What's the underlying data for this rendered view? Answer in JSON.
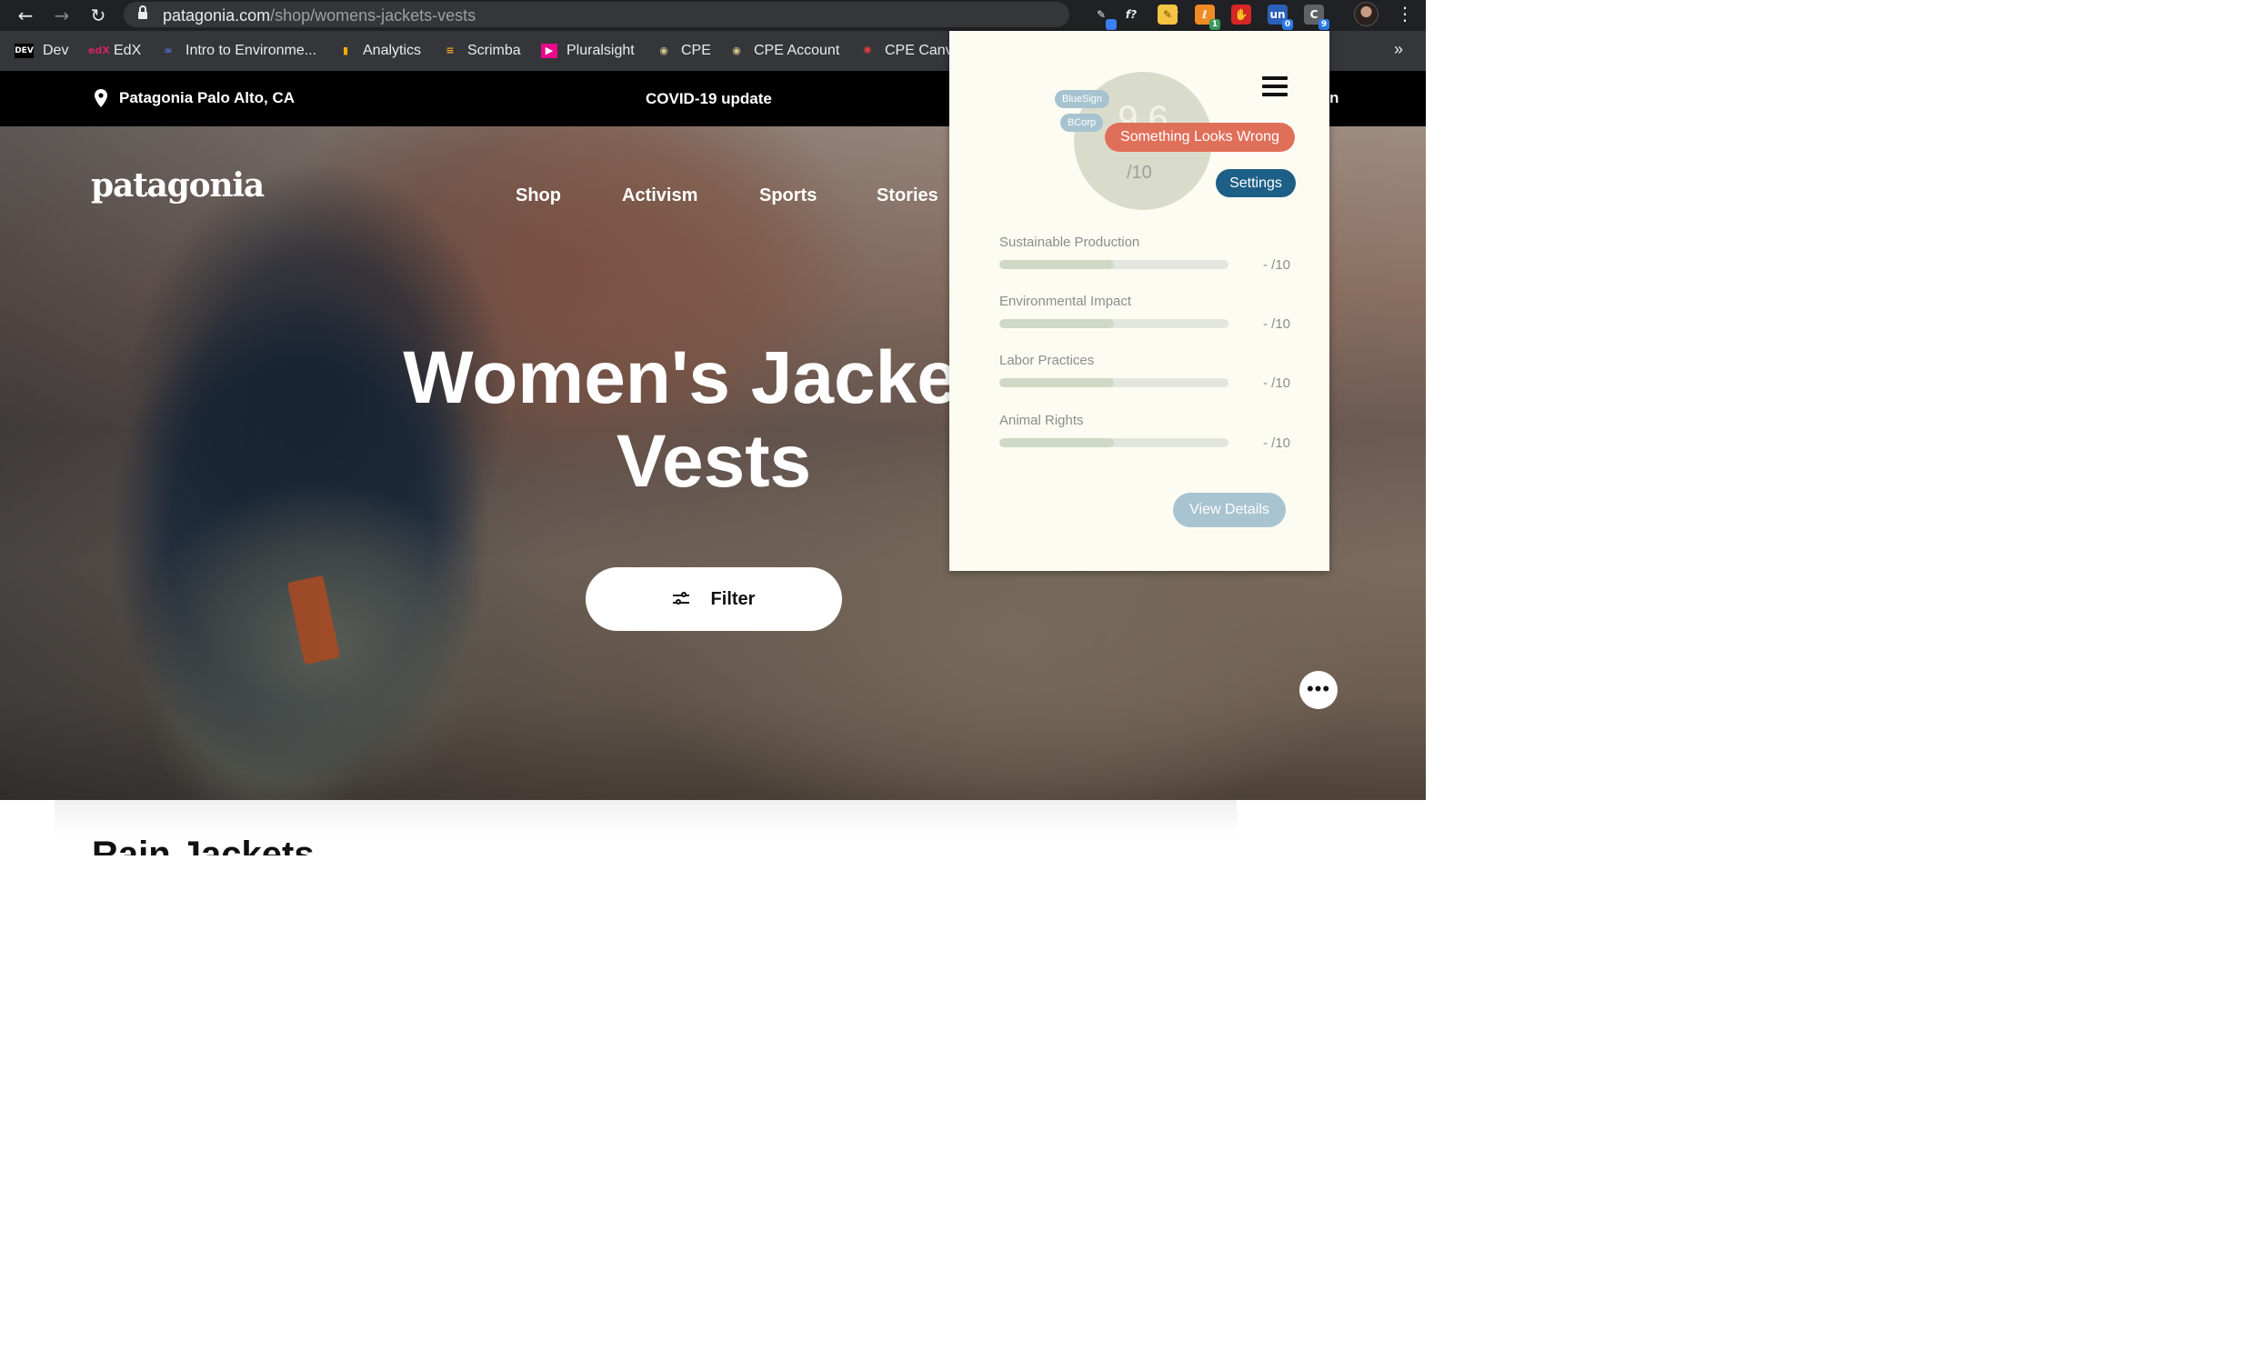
{
  "browser": {
    "url_host": "patagonia.com",
    "url_path": "/shop/womens-jackets-vests",
    "extensions": [
      {
        "name": "pen-extension-icon",
        "glyph": "✎",
        "bg": "#202124",
        "fg": "#e8eaed",
        "badge": "",
        "badge_color": "#3b82f6"
      },
      {
        "name": "function-extension-icon",
        "glyph": "f?",
        "bg": "#202124",
        "fg": "#e8eaed",
        "badge": "",
        "badge_color": ""
      },
      {
        "name": "notes-extension-icon",
        "glyph": "✎",
        "bg": "#f4c542",
        "fg": "#7a4b00",
        "badge": "",
        "badge_color": ""
      },
      {
        "name": "orange-extension-icon",
        "glyph": "ℓ",
        "bg": "#f08a24",
        "fg": "#fff",
        "badge": "1",
        "badge_color": "#3c9b5b"
      },
      {
        "name": "hand-extension-icon",
        "glyph": "✋",
        "bg": "#d62626",
        "fg": "#fff",
        "badge": "",
        "badge_color": ""
      },
      {
        "name": "un-extension-icon",
        "glyph": "un",
        "bg": "#2c5fb8",
        "fg": "#fff",
        "badge": "0",
        "badge_color": "#2c7be5"
      },
      {
        "name": "score-extension-icon",
        "glyph": "C",
        "bg": "#5f6368",
        "fg": "#fff",
        "badge": "9",
        "badge_color": "#2c7be5"
      }
    ]
  },
  "bookmarks": [
    {
      "label": "Dev",
      "icon": "DEV",
      "icon_bg": "#000",
      "icon_fg": "#fff",
      "icon_name": "dev-icon"
    },
    {
      "label": "EdX",
      "icon": "edX",
      "icon_bg": "transparent",
      "icon_fg": "#d0235f",
      "icon_name": "edx-icon"
    },
    {
      "label": "Intro to Environme...",
      "icon": "∞",
      "icon_bg": "transparent",
      "icon_fg": "#4f7be8",
      "icon_name": "coursera-icon"
    },
    {
      "label": "Analytics",
      "icon": "▮",
      "icon_bg": "transparent",
      "icon_fg": "#f9ab00",
      "icon_name": "analytics-icon"
    },
    {
      "label": "Scrimba",
      "icon": "≡",
      "icon_bg": "transparent",
      "icon_fg": "#f5a623",
      "icon_name": "scrimba-icon"
    },
    {
      "label": "Pluralsight",
      "icon": "▶",
      "icon_bg": "#e80a89",
      "icon_fg": "#fff",
      "icon_name": "pluralsight-icon"
    },
    {
      "label": "CPE",
      "icon": "◉",
      "icon_bg": "transparent",
      "icon_fg": "#d6c68a",
      "icon_name": "cpe-icon"
    },
    {
      "label": "CPE Account",
      "icon": "◉",
      "icon_bg": "transparent",
      "icon_fg": "#d6c68a",
      "icon_name": "cpe-account-icon"
    },
    {
      "label": "CPE Canv",
      "icon": "✺",
      "icon_bg": "transparent",
      "icon_fg": "#e13c3c",
      "icon_name": "canvas-icon"
    }
  ],
  "promo": {
    "store": "Patagonia Palo Alto, CA",
    "covid": "COVID-19 update",
    "right_partial": "n"
  },
  "site": {
    "logo": "patagonia",
    "nav": [
      "Shop",
      "Activism",
      "Sports",
      "Stories"
    ]
  },
  "hero": {
    "title_line1": "Women's Jackets",
    "title_line2": "Vests",
    "filter_label": "Filter",
    "more_label": "•••"
  },
  "section": {
    "title": "Rain Jackets"
  },
  "popup": {
    "score": "9.6",
    "score_max": "/10",
    "certifications": [
      "BlueSign",
      "BCorp"
    ],
    "report_label": "Something Looks Wrong",
    "settings_label": "Settings",
    "metrics": [
      {
        "label": "Sustainable Production",
        "score": "- /10",
        "fill": 0.5
      },
      {
        "label": "Environmental Impact",
        "score": "- /10",
        "fill": 0.5
      },
      {
        "label": "Labor Practices",
        "score": "- /10",
        "fill": 0.5
      },
      {
        "label": "Animal Rights",
        "score": "- /10",
        "fill": 0.5
      }
    ],
    "details_label": "View Details"
  }
}
